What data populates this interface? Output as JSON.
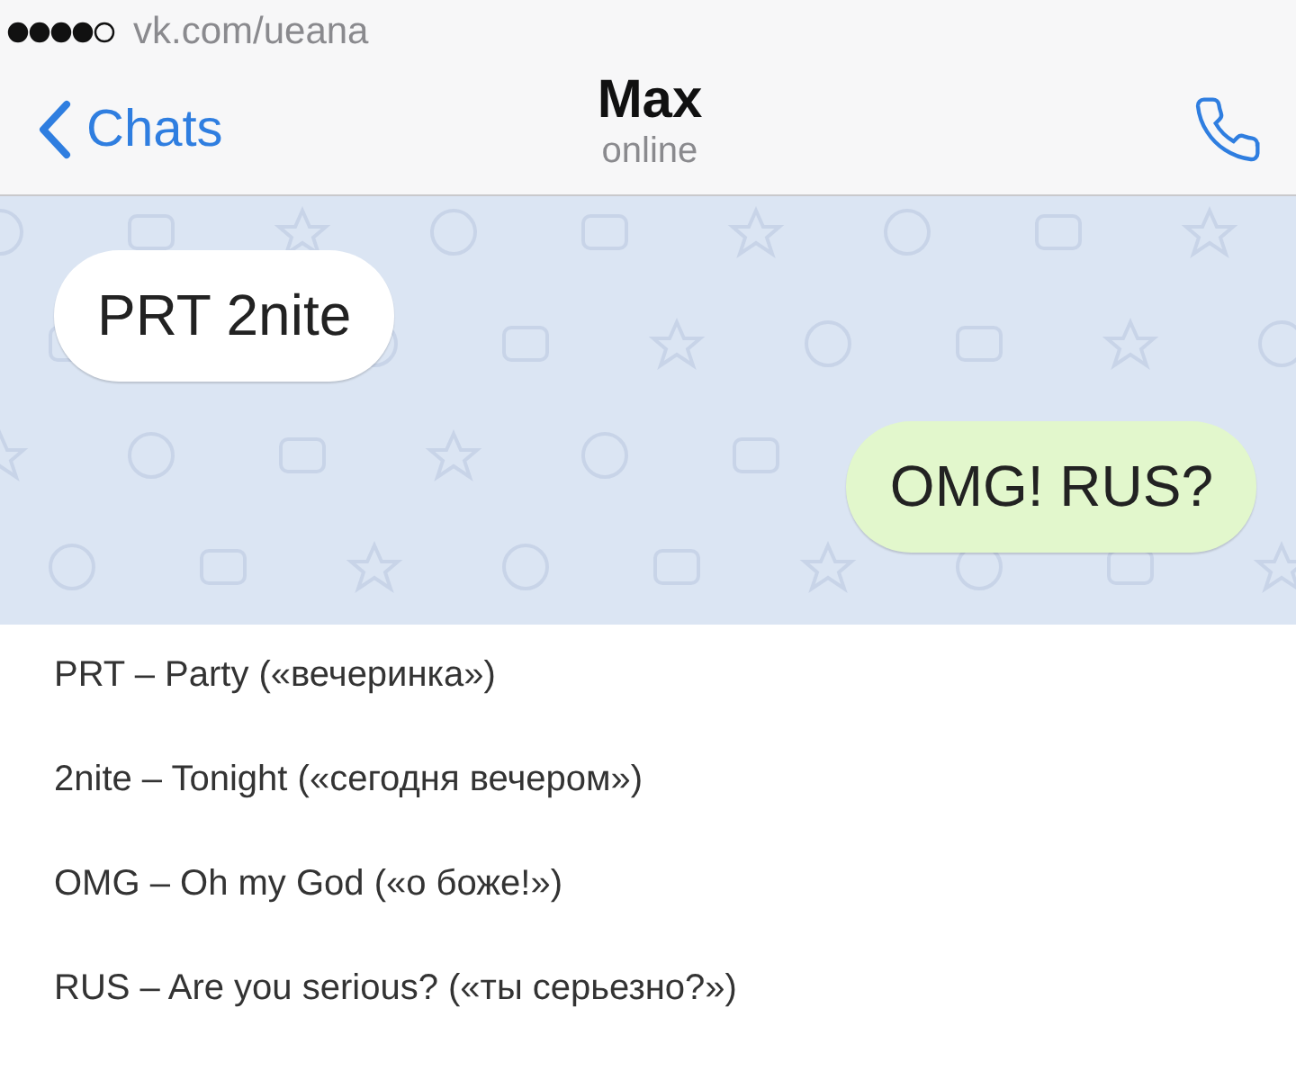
{
  "status_bar": {
    "carrier": "vk.com/ueana"
  },
  "header": {
    "back_label": "Chats",
    "title": "Max",
    "subtitle": "online"
  },
  "messages": [
    {
      "kind": "incoming",
      "text": "PRT 2nite"
    },
    {
      "kind": "outgoing",
      "text": "OMG! RUS?"
    }
  ],
  "glossary": [
    "PRT – Party («вечеринка»)",
    "2nite – Tonight («сегодня вечером»)",
    "OMG – Oh my God («о боже!»)",
    "RUS – Are you serious? («ты серьезно?»)"
  ]
}
